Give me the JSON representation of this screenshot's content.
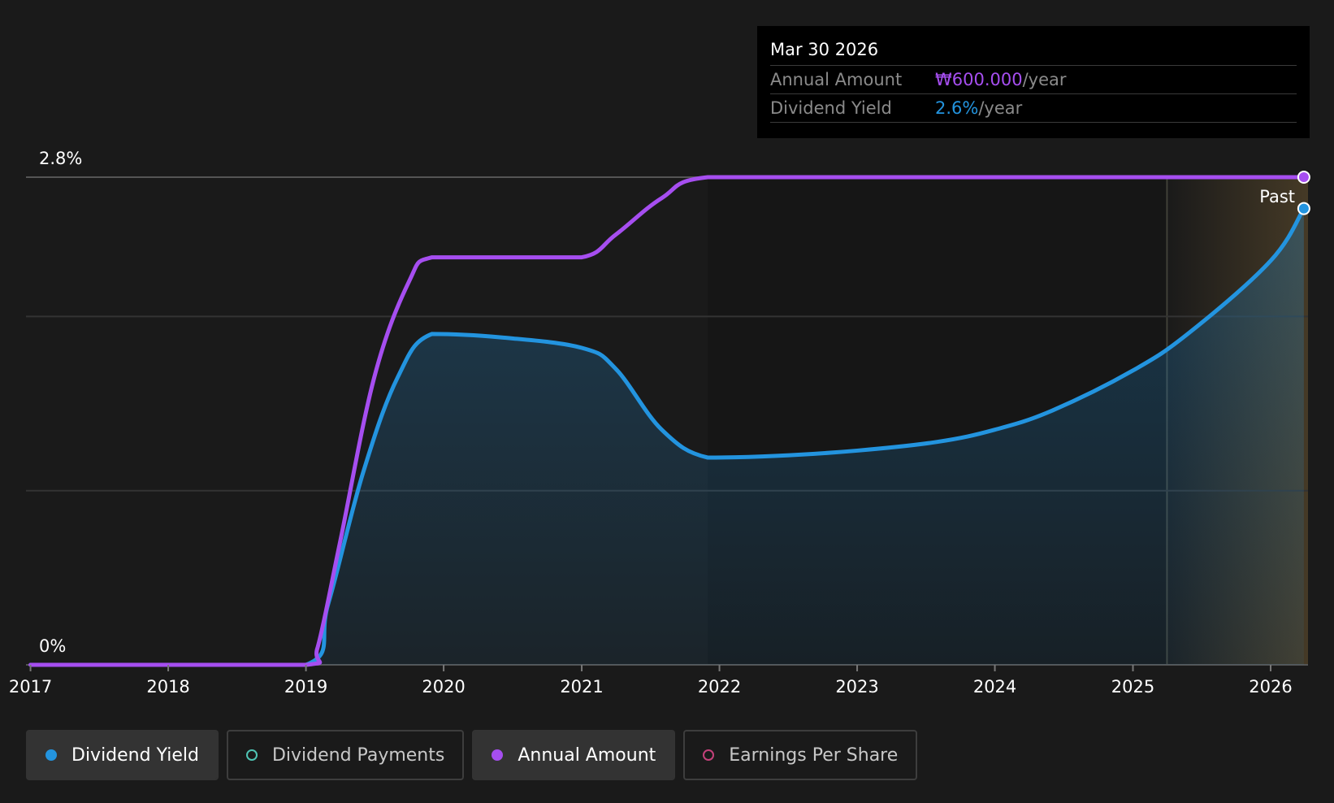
{
  "chart_data": {
    "type": "line",
    "ylim": [
      0,
      2.8
    ],
    "xlim": [
      "2016-12-20",
      "2026-04-10"
    ],
    "y_tick_labels": [
      "0%",
      "2.8%"
    ],
    "x_ticks": [
      "2017",
      "2018",
      "2019",
      "2020",
      "2021",
      "2022",
      "2023",
      "2024",
      "2025",
      "2026"
    ],
    "past_label": "Past",
    "past_start": "2025-04-01",
    "series": [
      {
        "name": "Annual Amount",
        "color": "#a64ef0",
        "x": [
          "2017-01-01",
          "2018-01-01",
          "2019-01-01",
          "2019-02-01",
          "2019-04-01",
          "2019-07-01",
          "2019-10-01",
          "2019-12-01",
          "2020-06-01",
          "2021-01-01",
          "2021-04-01",
          "2021-08-01",
          "2021-12-01",
          "2023-01-01",
          "2024-01-01",
          "2025-01-01",
          "2026-03-30"
        ],
        "values": [
          0,
          0,
          0,
          0.1,
          0.7,
          1.65,
          2.2,
          2.34,
          2.34,
          2.34,
          2.47,
          2.68,
          2.8,
          2.8,
          2.8,
          2.8,
          2.8
        ]
      },
      {
        "name": "Dividend Yield",
        "color": "#2394df",
        "x": [
          "2017-01-01",
          "2018-01-01",
          "2019-01-01",
          "2019-03-01",
          "2019-06-01",
          "2019-09-01",
          "2019-12-01",
          "2020-06-01",
          "2021-01-01",
          "2021-04-01",
          "2021-08-01",
          "2021-12-01",
          "2022-06-01",
          "2023-01-01",
          "2023-08-01",
          "2024-01-01",
          "2024-06-01",
          "2025-01-01",
          "2025-06-01",
          "2026-01-01",
          "2026-03-30"
        ],
        "values": [
          0,
          0,
          0,
          0.35,
          1.1,
          1.65,
          1.9,
          1.88,
          1.82,
          1.7,
          1.35,
          1.19,
          1.2,
          1.23,
          1.28,
          1.35,
          1.46,
          1.69,
          1.91,
          2.32,
          2.62
        ]
      }
    ]
  },
  "tooltip": {
    "date": "Mar 30 2026",
    "rows": [
      {
        "label": "Annual Amount",
        "value": "₩600.000",
        "unit": "/year",
        "color": "#a64ef0"
      },
      {
        "label": "Dividend Yield",
        "value": "2.6%",
        "unit": "/year",
        "color": "#2394df"
      }
    ]
  },
  "legend": [
    {
      "label": "Dividend Yield",
      "color": "#2394df",
      "active": true,
      "filled": true
    },
    {
      "label": "Dividend Payments",
      "color": "#4fc4b4",
      "active": false,
      "filled": false
    },
    {
      "label": "Annual Amount",
      "color": "#a64ef0",
      "active": true,
      "filled": true
    },
    {
      "label": "Earnings Per Share",
      "color": "#c4417a",
      "active": false,
      "filled": false
    }
  ]
}
